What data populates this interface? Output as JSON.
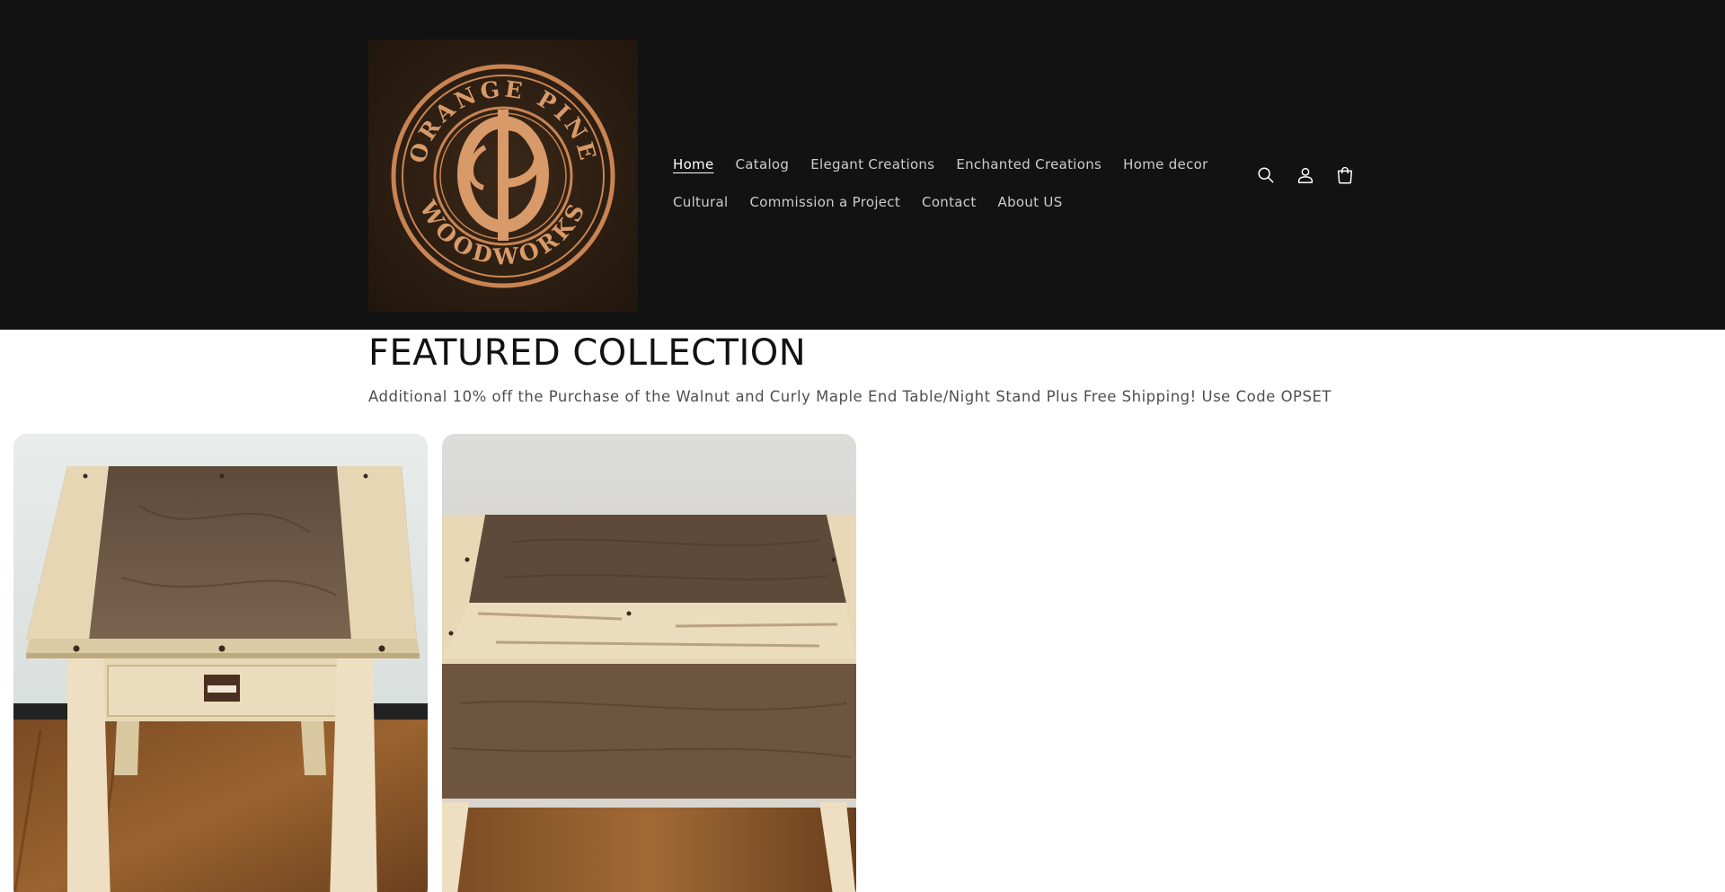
{
  "brand": {
    "logo_top_text": "ORANGE PINE",
    "logo_bottom_text": "WOODWORKS",
    "logo_monogram": "OP"
  },
  "nav": {
    "row1": [
      {
        "label": "Home",
        "active": true
      },
      {
        "label": "Catalog"
      },
      {
        "label": "Elegant Creations"
      },
      {
        "label": "Enchanted Creations"
      },
      {
        "label": "Home decor"
      }
    ],
    "row2": [
      {
        "label": "Cultural"
      },
      {
        "label": "Commission a Project"
      },
      {
        "label": "Contact"
      },
      {
        "label": "About US"
      }
    ]
  },
  "header_icons": [
    "search-icon",
    "account-icon",
    "cart-icon"
  ],
  "featured": {
    "title": "FEATURED COLLECTION",
    "subtitle": "Additional 10% off the Purchase of the Walnut and Curly Maple End Table/Night Stand Plus Free Shipping! Use Code OPSET"
  },
  "products": [
    {
      "image": "walnut-curly-maple-end-table-front"
    },
    {
      "image": "walnut-curly-maple-end-table-top"
    }
  ],
  "colors": {
    "header_bg": "#121212",
    "logo_copper": "#c98452",
    "logo_bg": "#2a1c12",
    "walnut": "#6e5540",
    "maple": "#e6d6b4"
  }
}
